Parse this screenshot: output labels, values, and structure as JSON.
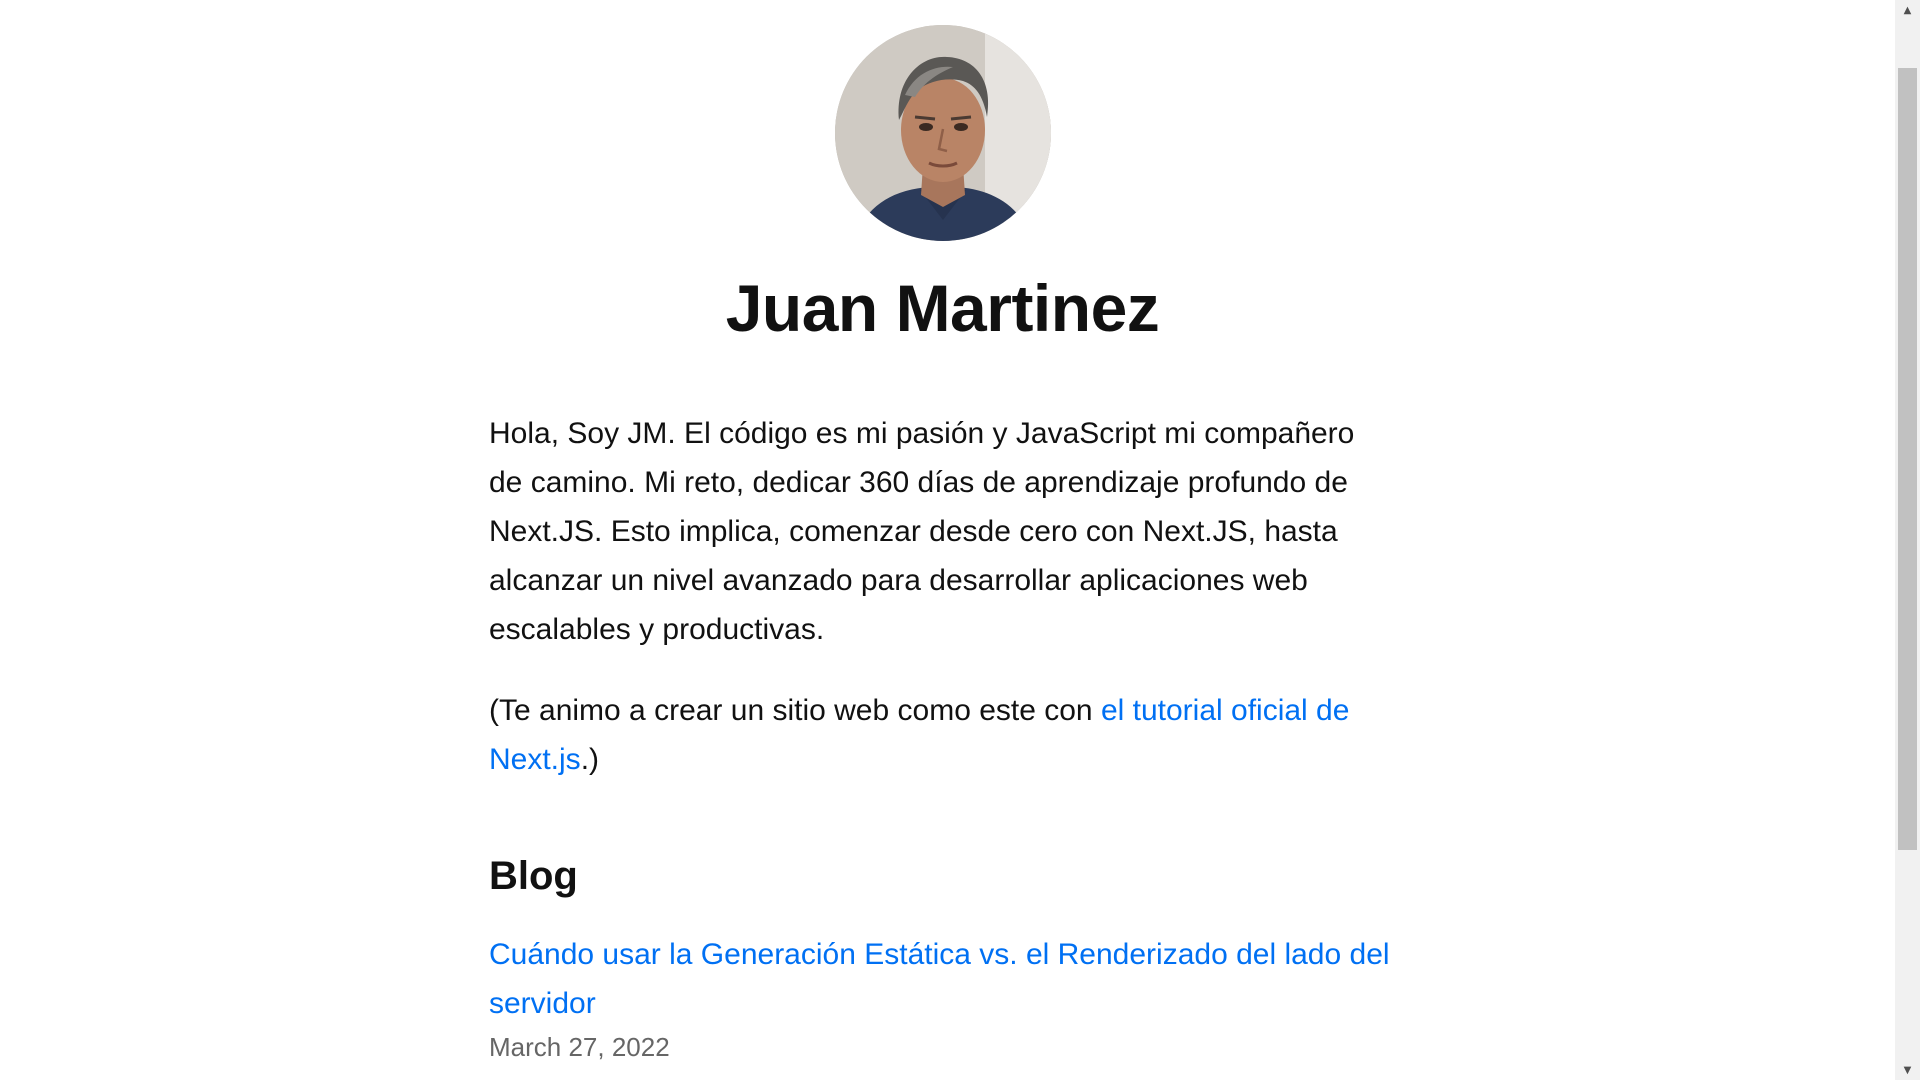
{
  "profile": {
    "name": "Juan Martinez",
    "avatar_alt": "profile-photo"
  },
  "intro": {
    "paragraph1": "Hola, Soy JM. El código es mi pasión y JavaScript mi compañero de camino. Mi reto, dedicar 360 días de aprendizaje profundo de Next.JS. Esto implica, comenzar desde cero con Next.JS, hasta alcanzar un nivel avanzado para desarrollar aplicaciones web escalables y productivas.",
    "paragraph2_prefix": "(Te animo a crear un sitio web como este con ",
    "paragraph2_link": "el tutorial oficial de Next.js",
    "paragraph2_suffix": ".)"
  },
  "blog": {
    "heading": "Blog",
    "posts": [
      {
        "title": "Cuándo usar la Generación Estática vs. el Renderizado del lado del servidor",
        "date": "March 27, 2022"
      }
    ]
  },
  "colors": {
    "link": "#0070f3",
    "text": "#111111",
    "date": "#666666",
    "background": "#ffffff"
  },
  "scrollbar": {
    "up_icon": "scroll-up-arrow-icon",
    "down_icon": "scroll-down-arrow-icon"
  }
}
